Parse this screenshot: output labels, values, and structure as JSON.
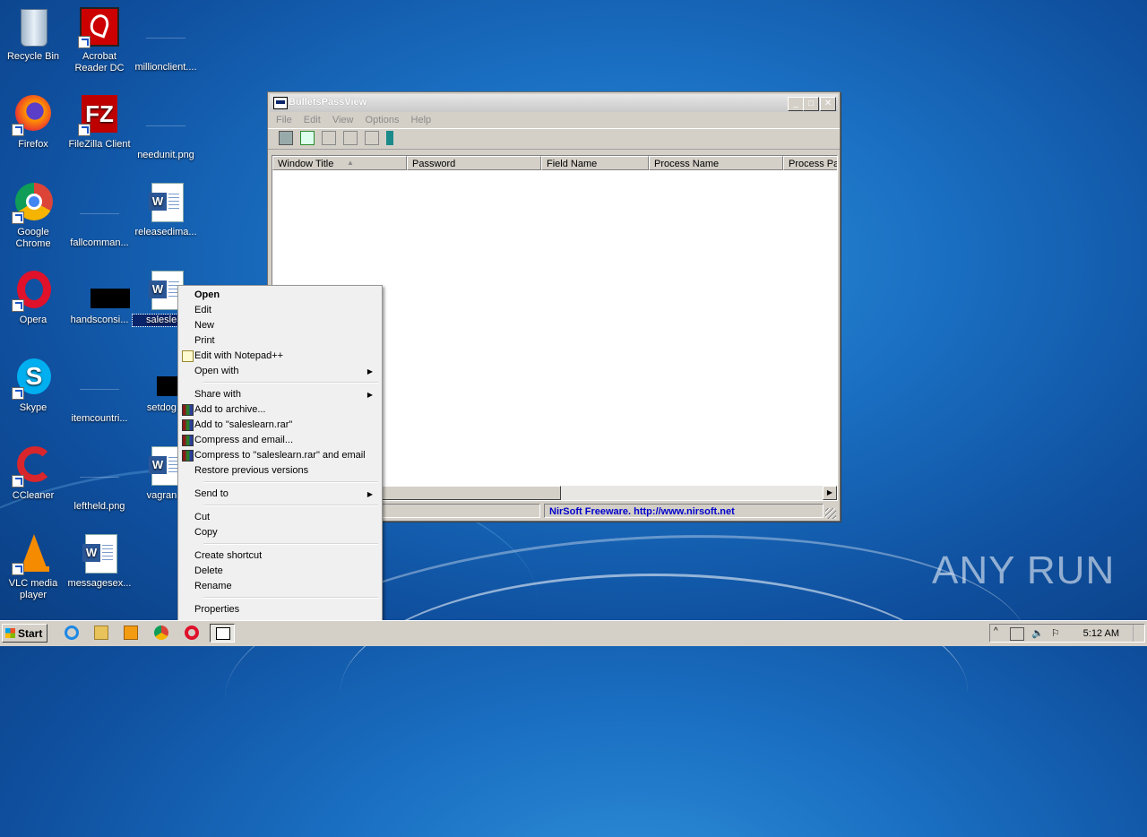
{
  "desktop": {
    "icons": [
      {
        "label": "Recycle Bin"
      },
      {
        "label": "Acrobat Reader DC"
      },
      {
        "label": "millionclient...."
      },
      {
        "label": "Firefox"
      },
      {
        "label": "FileZilla Client"
      },
      {
        "label": "needunit.png"
      },
      {
        "label": "Google Chrome"
      },
      {
        "label": "fallcomman..."
      },
      {
        "label": "releasedima..."
      },
      {
        "label": "Opera"
      },
      {
        "label": "handsconsi..."
      },
      {
        "label": "saleslear"
      },
      {
        "label": "Skype"
      },
      {
        "label": "itemcountri..."
      },
      {
        "label": "setdog..."
      },
      {
        "label": "CCleaner"
      },
      {
        "label": "leftheld.png"
      },
      {
        "label": "vagran..."
      },
      {
        "label": "VLC media player"
      },
      {
        "label": "messagesex..."
      }
    ]
  },
  "window": {
    "title": "BulletsPassView",
    "buttons": {
      "minimize": "_",
      "maximize": "□",
      "close": "✕"
    },
    "menu": [
      "File",
      "Edit",
      "View",
      "Options",
      "Help"
    ],
    "columns": [
      "Window Title",
      "Password",
      "Field Name",
      "Process Name",
      "Process Pat"
    ],
    "sort_indicator": "▲",
    "status": {
      "link_text": "NirSoft Freeware.  http://www.nirsoft.net"
    }
  },
  "context_menu": {
    "items": [
      {
        "label": "Open",
        "bold": true
      },
      {
        "label": "Edit"
      },
      {
        "label": "New"
      },
      {
        "label": "Print"
      },
      {
        "label": "Edit with Notepad++",
        "icon": "notepadpp-icon"
      },
      {
        "label": "Open with",
        "submenu": true
      },
      {
        "label": "Share with",
        "submenu": true
      },
      {
        "label": "Add to archive...",
        "icon": "winrar-icon"
      },
      {
        "label": "Add to \"saleslearn.rar\"",
        "icon": "winrar-icon"
      },
      {
        "label": "Compress and email...",
        "icon": "winrar-icon"
      },
      {
        "label": "Compress to \"saleslearn.rar\" and email",
        "icon": "winrar-icon"
      },
      {
        "label": "Restore previous versions"
      },
      {
        "label": "Send to",
        "submenu": true
      },
      {
        "label": "Cut"
      },
      {
        "label": "Copy"
      },
      {
        "label": "Create shortcut"
      },
      {
        "label": "Delete"
      },
      {
        "label": "Rename"
      },
      {
        "label": "Properties"
      }
    ]
  },
  "taskbar": {
    "start_label": "Start",
    "clock": "5:12 AM"
  },
  "watermark": "ANY RUN"
}
